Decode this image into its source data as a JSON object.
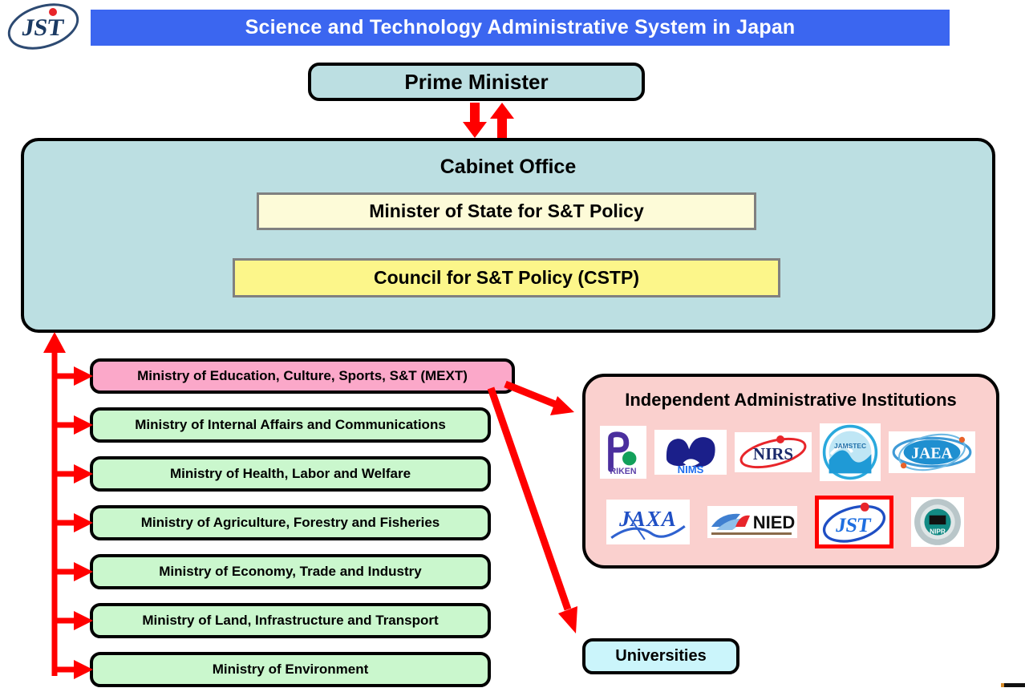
{
  "header": {
    "logo_alt": "JST",
    "title": "Science and Technology Administrative System in Japan"
  },
  "nodes": {
    "prime_minister": "Prime Minister",
    "cabinet_office": "Cabinet Office",
    "minister_of_state": "Minister of State for S&T Policy",
    "cstp": "Council for S&T Policy (CSTP)",
    "universities": "Universities"
  },
  "ministries": [
    {
      "label": "Ministry of Education, Culture, Sports, S&T (MEXT)",
      "highlight": true
    },
    {
      "label": "Ministry of Internal Affairs and Communications",
      "highlight": false
    },
    {
      "label": "Ministry of Health, Labor and Welfare",
      "highlight": false
    },
    {
      "label": "Ministry of Agriculture, Forestry and Fisheries",
      "highlight": false
    },
    {
      "label": "Ministry of Economy, Trade and Industry",
      "highlight": false
    },
    {
      "label": "Ministry of Land, Infrastructure and Transport",
      "highlight": false
    },
    {
      "label": "Ministry of Environment",
      "highlight": false
    }
  ],
  "institutions": {
    "title": "Independent Administrative Institutions",
    "logos": [
      {
        "name": "RIKEN",
        "highlight": false
      },
      {
        "name": "NIMS",
        "highlight": false
      },
      {
        "name": "NIRS",
        "highlight": false
      },
      {
        "name": "JAMSTEC",
        "highlight": false
      },
      {
        "name": "JAEA",
        "highlight": false
      },
      {
        "name": "JAXA",
        "highlight": false
      },
      {
        "name": "NIED",
        "highlight": false
      },
      {
        "name": "JST",
        "highlight": true
      },
      {
        "name": "NIPR",
        "highlight": false
      }
    ]
  },
  "colors": {
    "title_bar": "#3b66f0",
    "cabinet_bg": "#bcdfe2",
    "minister_bg": "#fdfbd8",
    "cstp_bg": "#fcf68a",
    "ministry_bg": "#caf7cd",
    "mext_bg": "#fba8c9",
    "iai_bg": "#fad0ce",
    "universities_bg": "#cbf5fb",
    "arrow": "#ff0000",
    "highlight_border": "#ff0000"
  }
}
